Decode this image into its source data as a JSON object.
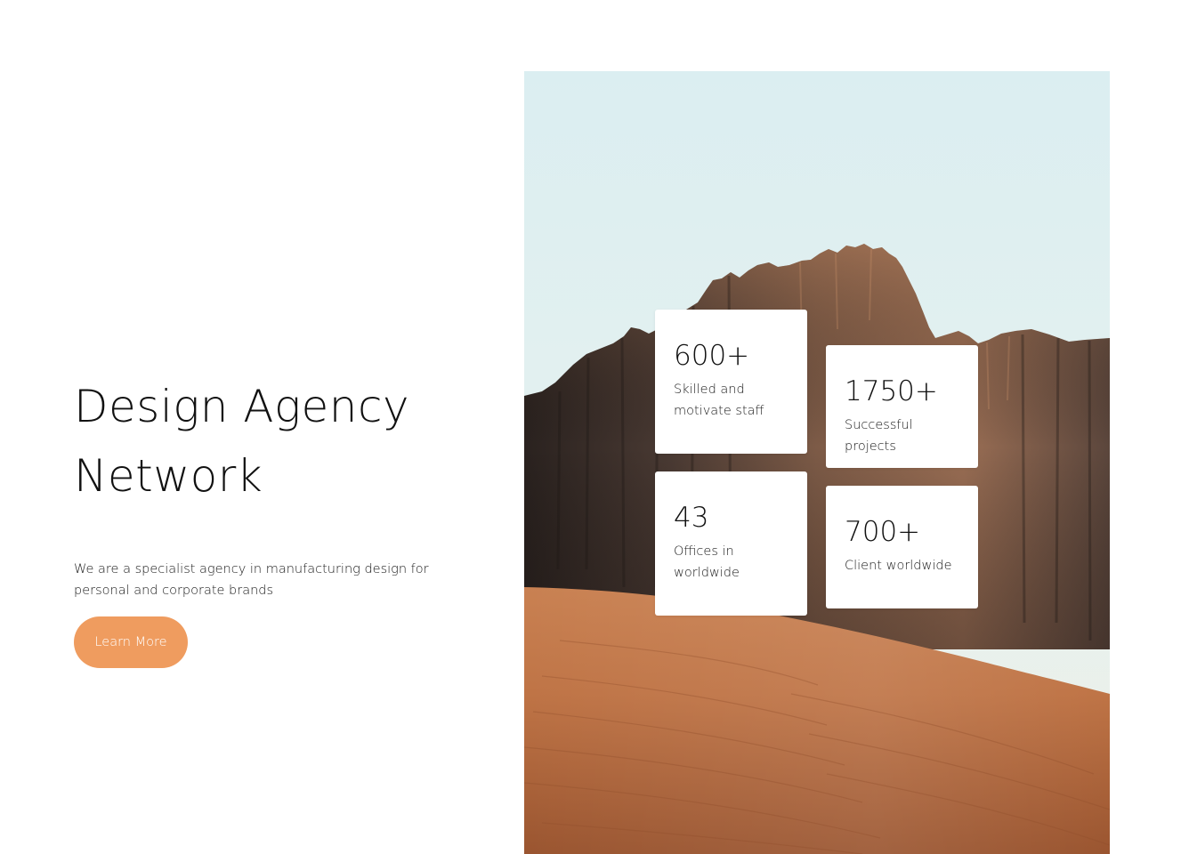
{
  "hero": {
    "title_line1": "Design Agency",
    "title_line2": "Network",
    "description": "We are a specialist agency in manufacturing design for personal and corporate brands",
    "cta_label": "Learn More"
  },
  "stats": [
    {
      "value": "600+",
      "label": "Skilled and motivate staff"
    },
    {
      "value": "1750+",
      "label": "Successful projects"
    },
    {
      "value": "43",
      "label": "Offices in worldwide"
    },
    {
      "value": "700+",
      "label": "Client worldwide"
    }
  ],
  "colors": {
    "accent": "#ef9c5f",
    "text": "#111111",
    "background": "#ffffff"
  }
}
